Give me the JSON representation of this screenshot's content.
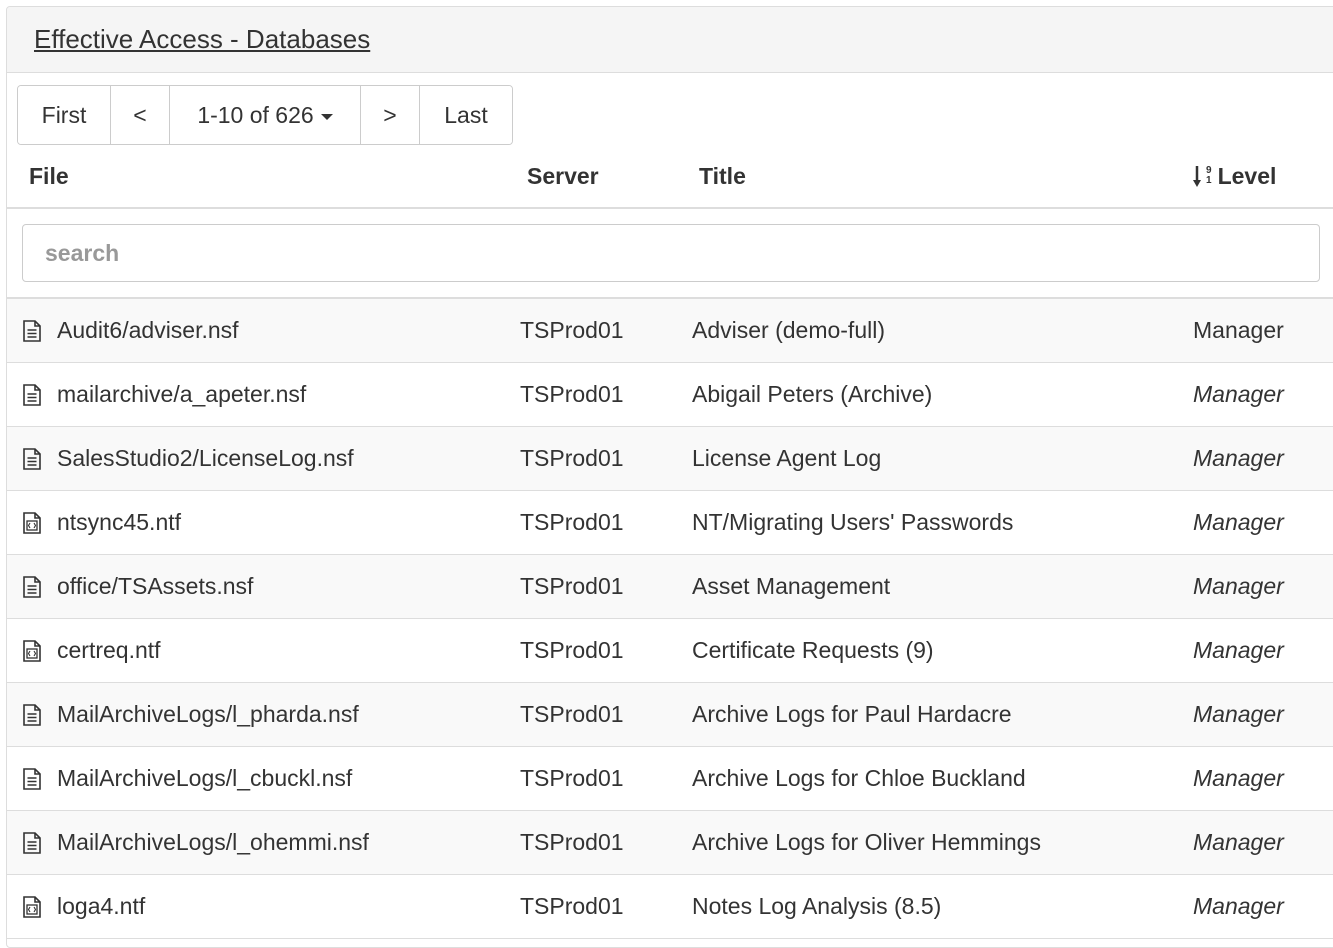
{
  "panel": {
    "title": "Effective Access - Databases"
  },
  "pager": {
    "first": "First",
    "prev": "<",
    "range": "1-10 of 626",
    "next": ">",
    "last": "Last"
  },
  "columns": {
    "file": "File",
    "server": "Server",
    "title": "Title",
    "level": "Level"
  },
  "search": {
    "placeholder": "search",
    "value": ""
  },
  "rows": [
    {
      "icon": "document-icon",
      "file": "Audit6/adviser.nsf",
      "server": "TSProd01",
      "title": "Adviser (demo-full)",
      "level": "Manager",
      "level_italic": false
    },
    {
      "icon": "document-icon",
      "file": "mailarchive/a_apeter.nsf",
      "server": "TSProd01",
      "title": "Abigail Peters (Archive)",
      "level": "Manager",
      "level_italic": true
    },
    {
      "icon": "document-icon",
      "file": "SalesStudio2/LicenseLog.nsf",
      "server": "TSProd01",
      "title": "License Agent Log",
      "level": "Manager",
      "level_italic": true
    },
    {
      "icon": "template-icon",
      "file": "ntsync45.ntf",
      "server": "TSProd01",
      "title": "NT/Migrating Users' Passwords",
      "level": "Manager",
      "level_italic": true
    },
    {
      "icon": "document-icon",
      "file": "office/TSAssets.nsf",
      "server": "TSProd01",
      "title": "Asset Management",
      "level": "Manager",
      "level_italic": true
    },
    {
      "icon": "template-icon",
      "file": "certreq.ntf",
      "server": "TSProd01",
      "title": "Certificate Requests (9)",
      "level": "Manager",
      "level_italic": true
    },
    {
      "icon": "document-icon",
      "file": "MailArchiveLogs/l_pharda.nsf",
      "server": "TSProd01",
      "title": "Archive Logs for Paul Hardacre",
      "level": "Manager",
      "level_italic": true
    },
    {
      "icon": "document-icon",
      "file": "MailArchiveLogs/l_cbuckl.nsf",
      "server": "TSProd01",
      "title": "Archive Logs for Chloe Buckland",
      "level": "Manager",
      "level_italic": true
    },
    {
      "icon": "document-icon",
      "file": "MailArchiveLogs/l_ohemmi.nsf",
      "server": "TSProd01",
      "title": "Archive Logs for Oliver Hemmings",
      "level": "Manager",
      "level_italic": true
    },
    {
      "icon": "template-icon",
      "file": "loga4.ntf",
      "server": "TSProd01",
      "title": "Notes Log Analysis (8.5)",
      "level": "Manager",
      "level_italic": true
    }
  ]
}
